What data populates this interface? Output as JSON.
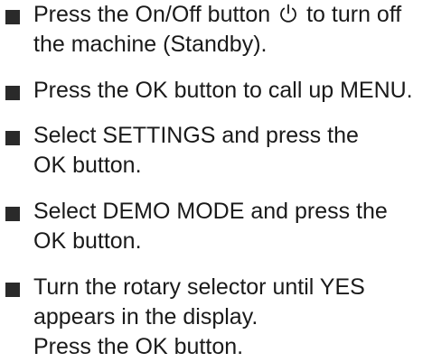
{
  "steps": [
    {
      "lines": [
        {
          "before": "Press the On/Off button",
          "icon": "power-icon",
          "after": "to turn off"
        },
        "the machine (Standby)."
      ]
    },
    {
      "lines": [
        "Press the OK button to call up MENU."
      ]
    },
    {
      "lines": [
        "Select SETTINGS and press the",
        "OK button."
      ]
    },
    {
      "lines": [
        "Select DEMO MODE and press the",
        "OK button."
      ]
    },
    {
      "lines": [
        "Turn the rotary selector until YES",
        "appears in the display.",
        "Press the OK button."
      ]
    }
  ]
}
